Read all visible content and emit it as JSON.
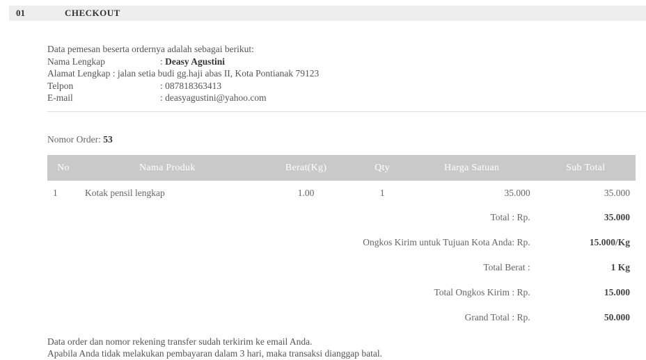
{
  "header": {
    "number": "01",
    "title": "CHECKOUT"
  },
  "customer": {
    "intro": "Data pemesan beserta ordernya adalah sebagai berikut:",
    "fields": [
      {
        "label": "Nama Lengkap",
        "sep": ": ",
        "value": "Deasy Agustini",
        "bold": true
      },
      {
        "label": "Alamat Lengkap",
        "sep": ": ",
        "value": "jalan setia budi gg.haji abas II, Kota Pontianak 79123"
      },
      {
        "label": "Telpon",
        "sep": ": ",
        "value": "087818363413"
      },
      {
        "label": "E-mail",
        "sep": ": ",
        "value": "deasyagustini@yahoo.com"
      }
    ]
  },
  "order": {
    "label": "Nomor Order:",
    "number": "53"
  },
  "table": {
    "headers": [
      "No",
      "Nama Produk",
      "Berat(Kg)",
      "Qty",
      "Harga Satuan",
      "Sub Total"
    ],
    "rows": [
      {
        "no": "1",
        "name": "Kotak pensil lengkap",
        "berat": "1.00",
        "qty": "1",
        "harga": "35.000",
        "sub": "35.000"
      }
    ],
    "summary": [
      {
        "label": "Total : Rp.",
        "value": "35.000"
      },
      {
        "label": "Ongkos Kirim untuk Tujuan Kota Anda: Rp.",
        "value": "15.000/Kg"
      },
      {
        "label": "Total Berat :",
        "value": "1 Kg"
      },
      {
        "label": "Total Ongkos Kirim : Rp.",
        "value": "15.000"
      },
      {
        "label": "Grand Total : Rp.",
        "value": "50.000"
      }
    ]
  },
  "footer": {
    "line1": "Data order dan nomor rekening transfer sudah terkirim ke email Anda.",
    "line2": "Apabila Anda tidak melakukan pembayaran dalam 3 hari, maka transaksi dianggap batal."
  }
}
